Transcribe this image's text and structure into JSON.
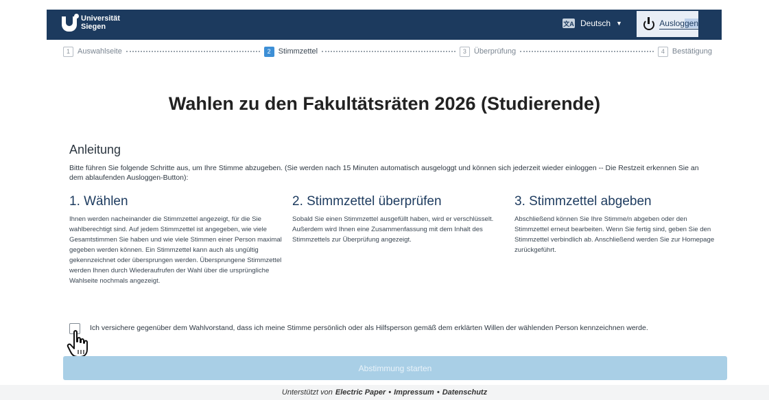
{
  "header": {
    "logo_line1": "Universität",
    "logo_line2": "Siegen",
    "language_icon": "translate-icon",
    "language_label": "Deutsch",
    "logout_label_a": "Auslog",
    "logout_label_b": "gen",
    "logout_icon": "power-icon"
  },
  "steps": [
    {
      "num": "1",
      "label": "Auswahlseite"
    },
    {
      "num": "2",
      "label": "Stimmzettel",
      "active": true
    },
    {
      "num": "3",
      "label": "Überprüfung"
    },
    {
      "num": "4",
      "label": "Bestätigung"
    }
  ],
  "main": {
    "title": "Wahlen zu den Fakultätsräten 2026 (Studierende)",
    "instructions_heading": "Anleitung",
    "instructions_text": "Bitte führen Sie folgende Schritte aus, um Ihre Stimme abzugeben. (Sie werden nach 15 Minuten automatisch ausgeloggt und können sich jederzeit wieder einloggen -- Die Restzeit erkennen Sie an dem ablaufenden Ausloggen-Button):",
    "columns": [
      {
        "heading": "1. Wählen",
        "text": "Ihnen werden nacheinander die Stimmzettel angezeigt, für die Sie wahlberechtigt sind. Auf jedem Stimmzettel ist angegeben, wie viele Gesamtstimmen Sie haben und wie viele Stimmen einer Person maximal gegeben werden können. Ein Stimmzettel kann auch als ungültig gekennzeichnet oder übersprungen werden. Übersprungene Stimmzettel werden Ihnen durch Wiederaufrufen der Wahl über die ursprüngliche Wahlseite nochmals angezeigt."
      },
      {
        "heading": "2. Stimmzettel überprüfen",
        "text": "Sobald Sie einen Stimmzettel ausgefüllt haben, wird er verschlüsselt. Außerdem wird Ihnen eine Zusammenfassung mit dem Inhalt des Stimmzettels zur Überprüfung angezeigt."
      },
      {
        "heading": "3. Stimmzettel abgeben",
        "text": "Abschließend können Sie Ihre Stimme/n abgeben oder den Stimmzettel erneut bearbeiten. Wenn Sie fertig sind, geben Sie den Stimmzettel verbindlich ab. Anschließend werden Sie zur Homepage zurückgeführt."
      }
    ],
    "consent_text": "Ich versichere gegenüber dem Wahlvorstand, dass ich meine Stimme persönlich oder als Hilfsperson gemäß dem erklärten Willen der wählenden Person kennzeichnen werde.",
    "consent_checked": false,
    "start_button": "Abstimmung starten"
  },
  "footer": {
    "prefix": "Unterstützt von",
    "brand": "Electric Paper",
    "sep1": "•",
    "impressum": "Impressum",
    "sep2": "•",
    "datenschutz": "Datenschutz"
  },
  "colors": {
    "navbar": "#1c3a5e",
    "active_step": "#3d8fd6",
    "start_button": "#a9cfe6"
  }
}
